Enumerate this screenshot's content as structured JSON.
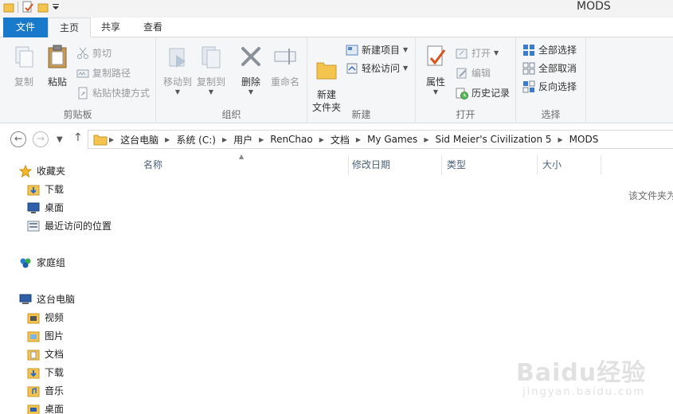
{
  "window": {
    "title": "MODS"
  },
  "ribbon_tabs": [
    {
      "label": "文件"
    },
    {
      "label": "主页"
    },
    {
      "label": "共享"
    },
    {
      "label": "查看"
    }
  ],
  "ribbon": {
    "clipboard": {
      "label": "剪贴板",
      "copy": "复制",
      "paste": "粘贴",
      "cut": "剪切",
      "copy_path": "复制路径",
      "paste_shortcut": "粘贴快捷方式"
    },
    "organize": {
      "label": "组织",
      "move_to": "移动到",
      "copy_to": "复制到",
      "delete": "删除",
      "rename": "重命名"
    },
    "new": {
      "label": "新建",
      "new_folder": "新建\n文件夹",
      "new_item": "新建项目",
      "easy_access": "轻松访问"
    },
    "open": {
      "label": "打开",
      "properties": "属性",
      "open": "打开",
      "edit": "编辑",
      "history": "历史记录"
    },
    "select": {
      "label": "选择",
      "select_all": "全部选择",
      "select_none": "全部取消",
      "invert": "反向选择"
    }
  },
  "address": {
    "crumbs": [
      "这台电脑",
      "系统 (C:)",
      "用户",
      "RenChao",
      "文档",
      "My Games",
      "Sid Meier's Civilization 5",
      "MODS"
    ]
  },
  "nav_pane": {
    "favorites": "收藏夹",
    "fav_items": [
      "下载",
      "桌面",
      "最近访问的位置"
    ],
    "homegroup": "家庭组",
    "this_pc": "这台电脑",
    "pc_items": [
      "视频",
      "图片",
      "文档",
      "下载",
      "音乐",
      "桌面"
    ]
  },
  "columns": [
    "名称",
    "修改日期",
    "类型",
    "大小"
  ],
  "empty_message": "该文件夹为",
  "watermark": {
    "brand": "Baidu经验",
    "url": "jingyan.baidu.com"
  },
  "colors": {
    "accent": "#1979ca",
    "ribbon_bg": "#f5f6f7",
    "folder": "#f4c44e",
    "column_header": "#4c607a"
  }
}
